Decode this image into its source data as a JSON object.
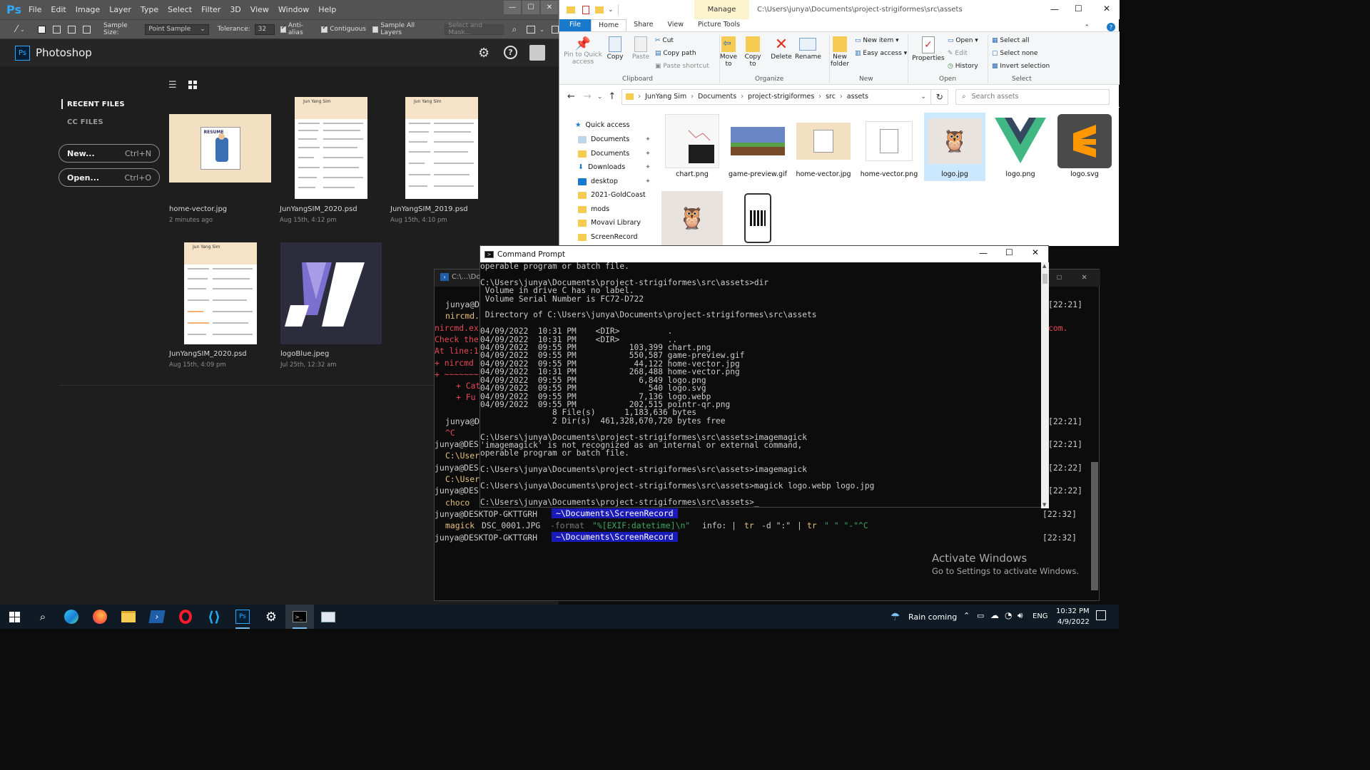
{
  "photoshop": {
    "logo": "Ps",
    "menu": [
      "File",
      "Edit",
      "Image",
      "Layer",
      "Type",
      "Select",
      "Filter",
      "3D",
      "View",
      "Window",
      "Help"
    ],
    "options": {
      "sample_size_label": "Sample Size:",
      "sample_size_value": "Point Sample",
      "tolerance_label": "Tolerance:",
      "tolerance_value": "32",
      "antialias": "Anti-alias",
      "contiguous": "Contiguous",
      "sample_all": "Sample All Layers",
      "select_mask": "Select and Mask..."
    },
    "home_badge": "Ps",
    "home_title": "Photoshop",
    "recent_files": "RECENT FILES",
    "cc_files": "CC FILES",
    "new_label": "New...",
    "new_shortcut": "Ctrl+N",
    "open_label": "Open...",
    "open_shortcut": "Ctrl+O",
    "files": [
      {
        "name": "home-vector.jpg",
        "date": "2 minutes ago"
      },
      {
        "name": "JunYangSIM_2020.psd",
        "date": "Aug 15th, 4:12 pm"
      },
      {
        "name": "JunYangSIM_2019.psd",
        "date": "Aug 15th, 4:10 pm"
      },
      {
        "name": "JunYangSIM_2020.psd",
        "date": "Aug 15th, 4:09 pm"
      },
      {
        "name": "logoBlue.jpeg",
        "date": "Jul 25th, 12:32 am"
      }
    ],
    "resume_name": "Jun Yang Sim",
    "vector_label": "RESUME"
  },
  "explorer": {
    "title_tab": "Manage",
    "path_title": "C:\\Users\\junya\\Documents\\project-strigiformes\\src\\assets",
    "tabs": [
      "File",
      "Home",
      "Share",
      "View",
      "Picture Tools"
    ],
    "ribbon": {
      "pin": "Pin to Quick access",
      "copy": "Copy",
      "paste": "Paste",
      "cut": "Cut",
      "copy_path": "Copy path",
      "paste_shortcut": "Paste shortcut",
      "clipboard": "Clipboard",
      "move_to": "Move to",
      "copy_to": "Copy to",
      "delete": "Delete",
      "rename": "Rename",
      "organize": "Organize",
      "new_folder": "New folder",
      "new_item": "New item",
      "easy_access": "Easy access",
      "new_group": "New",
      "properties": "Properties",
      "open": "Open",
      "edit": "Edit",
      "history": "History",
      "open_group": "Open",
      "select_all": "Select all",
      "select_none": "Select none",
      "invert": "Invert selection",
      "select_group": "Select"
    },
    "breadcrumb": [
      "JunYang Sim",
      "Documents",
      "project-strigiformes",
      "src",
      "assets"
    ],
    "search_placeholder": "Search assets",
    "nav": [
      "Quick access",
      "Documents",
      "Documents",
      "Downloads",
      "desktop",
      "2021-GoldCoast",
      "mods",
      "Movavi Library",
      "ScreenRecord"
    ],
    "files": [
      "chart.png",
      "game-preview.gif",
      "home-vector.jpg",
      "home-vector.png",
      "logo.jpg",
      "logo.png",
      "logo.svg"
    ]
  },
  "cmd": {
    "title": "Command Prompt",
    "lines": [
      "operable program or batch file.",
      "",
      "C:\\Users\\junya\\Documents\\project-strigiformes\\src\\assets>dir",
      " Volume in drive C has no label.",
      " Volume Serial Number is FC72-D722",
      "",
      " Directory of C:\\Users\\junya\\Documents\\project-strigiformes\\src\\assets",
      "",
      "04/09/2022  10:31 PM    <DIR>          .",
      "04/09/2022  10:31 PM    <DIR>          ..",
      "04/09/2022  09:55 PM           103,399 chart.png",
      "04/09/2022  09:55 PM           550,587 game-preview.gif",
      "04/09/2022  09:55 PM            44,122 home-vector.jpg",
      "04/09/2022  10:31 PM           268,488 home-vector.png",
      "04/09/2022  09:55 PM             6,849 logo.png",
      "04/09/2022  09:55 PM               540 logo.svg",
      "04/09/2022  09:55 PM             7,136 logo.webp",
      "04/09/2022  09:55 PM           202,515 pointr-qr.png",
      "               8 File(s)      1,183,636 bytes",
      "               2 Dir(s)  461,328,670,720 bytes free",
      "",
      "C:\\Users\\junya\\Documents\\project-strigiformes\\src\\assets>imagemagick",
      "'imagemagick' is not recognized as an internal or external command,",
      "operable program or batch file.",
      "",
      "C:\\Users\\junya\\Documents\\project-strigiformes\\src\\assets>imagemagick",
      "",
      "C:\\Users\\junya\\Documents\\project-strigiformes\\src\\assets>magick logo.webp logo.jpg",
      "",
      "C:\\Users\\junya\\Documents\\project-strigiformes\\src\\assets>_"
    ]
  },
  "terminal": {
    "tab": "C:\\...\\Do",
    "prompt_user": "junya@DESKTOP-GKTTGRH",
    "prompt_path": "~\\Documents\\ScreenRecord",
    "cmd_magick": "magick",
    "cmd_file": "DSC_0001.JPG",
    "cmd_flag": "-format",
    "cmd_fmt": "\"%[EXIF:datetime]\\n\"",
    "cmd_rest1": "info: |",
    "cmd_tr1": "tr",
    "cmd_tr1_arg": "-d \":\"",
    "cmd_pipe": "|",
    "cmd_tr2": "tr",
    "cmd_tr2_arg": "\" \" \"-\"^C",
    "times": [
      "[22:21]",
      "[22:21]",
      "[22:21]",
      "[22:22]",
      "[22:22]",
      "[22:32]",
      "[22:32]"
    ],
    "partials": [
      "junya@D",
      "nircmd.",
      "nircmd.ex",
      "Check the",
      "At line:1",
      "+ nircmd",
      "+ ~~~~~~~",
      "+ Cat",
      "+ Fu",
      "junya@D",
      "^C",
      "junya@DES",
      "C:\\User",
      "junya@DES",
      "C:\\User",
      "junya@DES",
      "choco"
    ],
    "right_partial": "com."
  },
  "watermark": {
    "title": "Activate Windows",
    "sub": "Go to Settings to activate Windows."
  },
  "taskbar": {
    "weather": "Rain coming",
    "lang": "ENG",
    "time": "10:32 PM",
    "date": "4/9/2022"
  }
}
